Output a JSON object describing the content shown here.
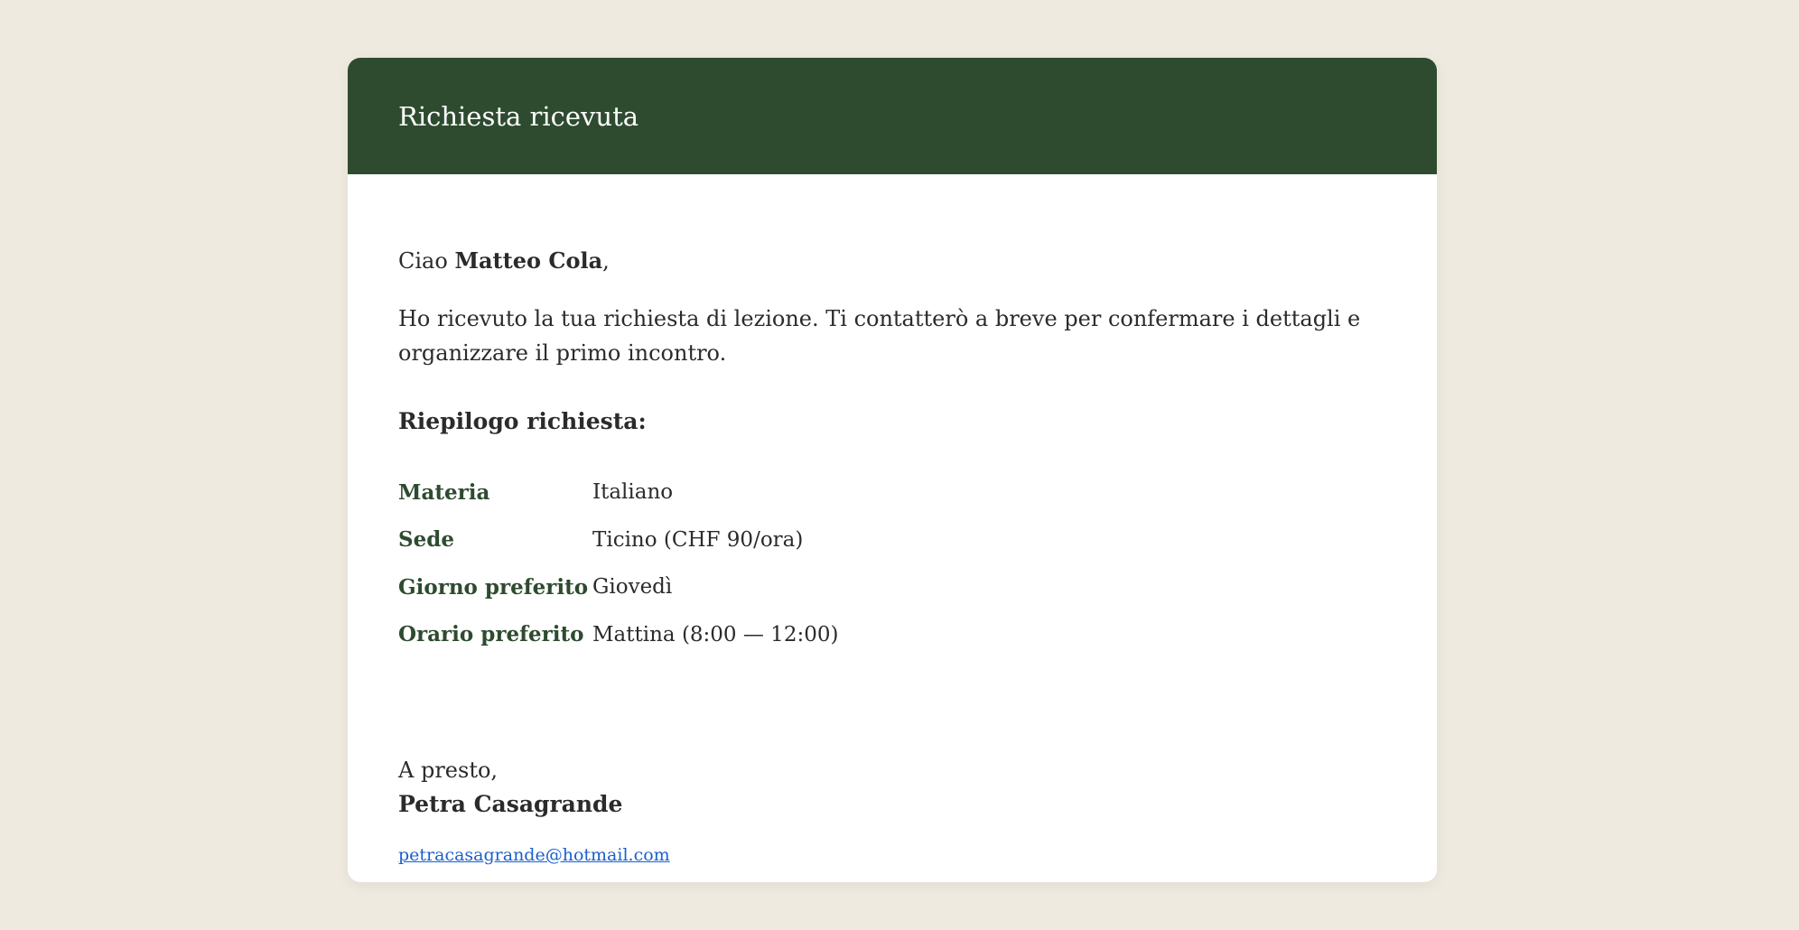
{
  "header": {
    "title": "Richiesta ricevuta"
  },
  "greeting": {
    "prefix": "Ciao ",
    "name": "Matteo Cola",
    "suffix": ","
  },
  "message": "Ho ricevuto la tua richiesta di lezione. Ti contatterò a breve per confermare i dettagli e organizzare il primo incontro.",
  "summary": {
    "title": "Riepilogo richiesta:",
    "rows": [
      {
        "label": "Materia",
        "value": "Italiano"
      },
      {
        "label": "Sede",
        "value": "Ticino (CHF 90/ora)"
      },
      {
        "label": "Giorno preferito",
        "value": "Giovedì"
      },
      {
        "label": "Orario preferito",
        "value": "Mattina (8:00 — 12:00)"
      }
    ]
  },
  "signoff": {
    "line": "A presto,",
    "name": "Petra Casagrande",
    "email": "petracasagrande@hotmail.com"
  },
  "colors": {
    "header_bg": "#2e4b2f",
    "page_bg": "#efeae0",
    "label_color": "#2e4b2f",
    "link_color": "#1a5fd0"
  }
}
